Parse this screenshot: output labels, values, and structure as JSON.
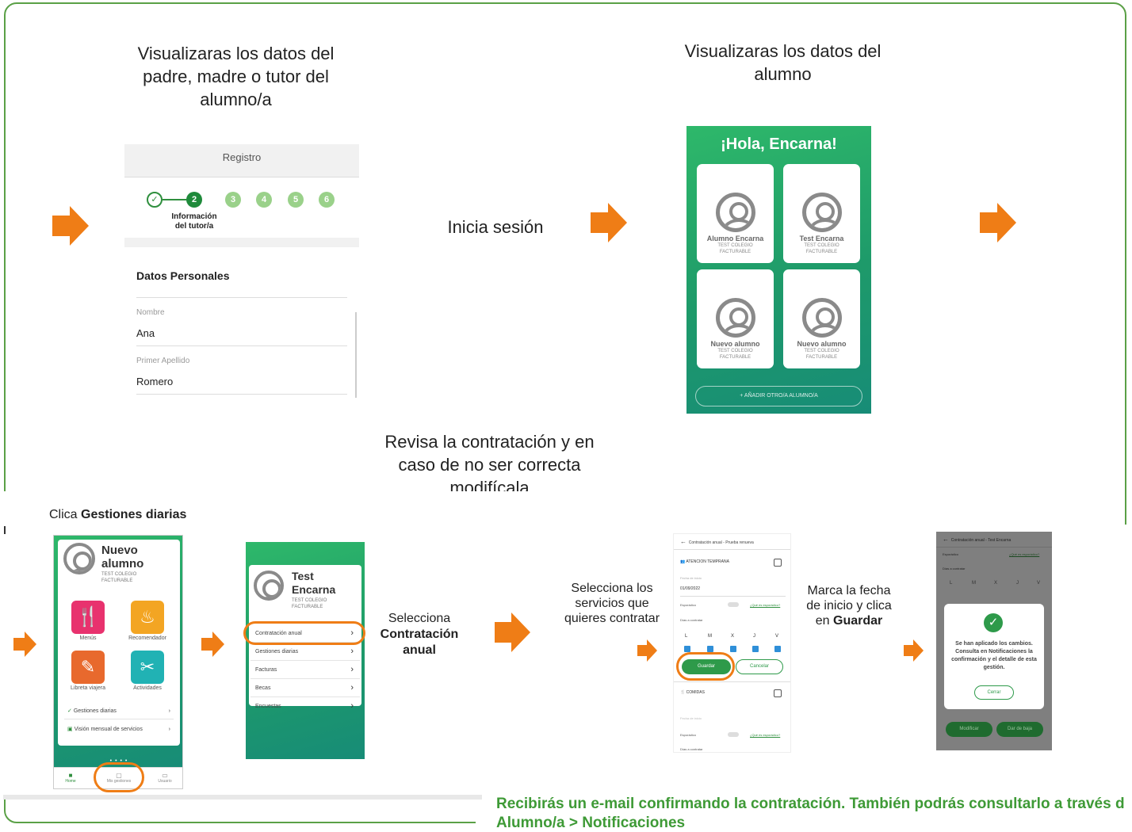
{
  "step1": {
    "caption": "Visualizaras los datos del padre, madre o tutor del alumno/a"
  },
  "registro": {
    "title": "Registro",
    "steps": [
      "2",
      "3",
      "4",
      "5",
      "6"
    ],
    "step_label_line1": "Información",
    "step_label_line2": "del tutor/a",
    "section_title": "Datos Personales",
    "field1_label": "Nombre",
    "field1_value": "Ana",
    "field2_label": "Primer Apellido",
    "field2_value": "Romero"
  },
  "step2": {
    "caption": "Inicia sesión"
  },
  "step3": {
    "caption": "Visualizaras los datos del alumno"
  },
  "hola": {
    "title": "¡Hola, Encarna!",
    "cards": [
      {
        "name": "Alumno Encarna",
        "sub1": "TEST COLEGIO",
        "sub2": "FACTURABLE"
      },
      {
        "name": "Test Encarna",
        "sub1": "TEST COLEGIO",
        "sub2": "FACTURABLE"
      },
      {
        "name": "Nuevo alumno",
        "sub1": "TEST COLEGIO",
        "sub2": "FACTURABLE"
      },
      {
        "name": "Nuevo alumno",
        "sub1": "TEST COLEGIO",
        "sub2": "FACTURABLE"
      }
    ],
    "add_button": "+ AÑADIR OTRO/A ALUMNO/A"
  },
  "step4": {
    "caption": "Revisa la contratación y en caso de no ser correcta modifícala"
  },
  "step5": {
    "caption_prefix": "Clica ",
    "caption_bold": "Gestiones diarias"
  },
  "alumno_home": {
    "name_line1": "Nuevo",
    "name_line2": "alumno",
    "sub1": "TEST COLEGIO",
    "sub2": "FACTURABLE",
    "tiles": [
      "Menús",
      "Recomendador",
      "Libreta viajera",
      "Actividades"
    ],
    "links": [
      "Gestiones diarias",
      "Visión mensual de servicios"
    ],
    "nav": [
      "Home",
      "Mis gestiones",
      "Usuario"
    ]
  },
  "gestiones": {
    "name_line1": "Test",
    "name_line2": "Encarna",
    "sub1": "TEST COLEGIO",
    "sub2": "FACTURABLE",
    "items": [
      "Contratación anual",
      "Gestiones diarias",
      "Facturas",
      "Becas",
      "Encuestas"
    ]
  },
  "step6": {
    "line1": "Selecciona",
    "bold1": "Contratación",
    "bold2": "anual"
  },
  "step7": {
    "caption": "Selecciona los servicios que quieres contratar"
  },
  "contratacion": {
    "header": "Contratación anual - Prueba renueva",
    "section1": "ATENCION TEMPRANA",
    "date_label": "Fecha de inicio",
    "date_value": "01/09/2022",
    "esporadico": "Esporádico",
    "que_es": "¿Qué es esporádico?",
    "dias": "Días a contratar",
    "days": [
      "L",
      "M",
      "X",
      "J",
      "V"
    ],
    "save": "Guardar",
    "cancel": "Cancelar",
    "section2": "COMIDAS",
    "date_label2": "Fecha de inicio"
  },
  "step8": {
    "line1": "Marca la fecha",
    "line2": "de inicio y clica",
    "prefix3": "en ",
    "bold3": "Guardar"
  },
  "confirm": {
    "header": "Contratación anual - Test Encarna",
    "esporadico": "Esporádico",
    "que_es": "¿Qué es esporádico?",
    "dias": "Días a contratar",
    "days": [
      "L",
      "M",
      "X",
      "J",
      "V"
    ],
    "message": "Se han aplicado los cambios. Consulta en Notificaciones la confirmación y el detalle de esta gestión.",
    "close": "Cerrar",
    "btn_left": "Modificar",
    "btn_right": "Dar de baja"
  },
  "footer": {
    "line1": "Recibirás un e-mail confirmando la contratación. También podrás consultarlo a través d",
    "line2": "Alumno/a > Notificaciones"
  },
  "colors": {
    "accent_orange": "#ef7d16",
    "frame_green": "#5aa046",
    "app_green": "#1e9a6a",
    "footer_green": "#3e9a36"
  }
}
